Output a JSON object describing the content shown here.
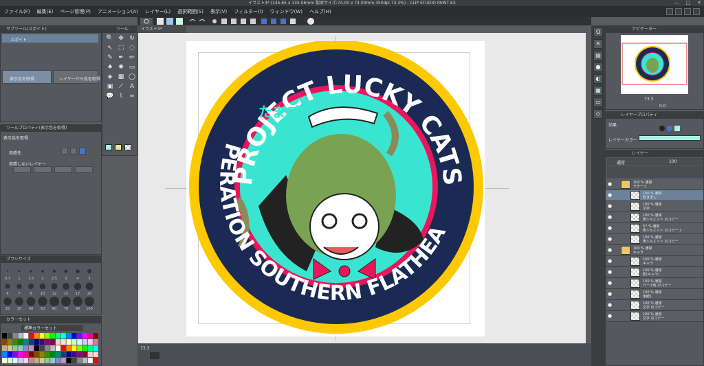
{
  "titlebar": {
    "title": "イラスト3* (145.65 x 135.06mm 製本サイズ:74.00 x 74.00mm 350dpi 73.3%) - CLIP STUDIO PAINT EX",
    "min": "—",
    "max": "□",
    "close": "✕"
  },
  "menu": [
    "ファイル(F)",
    "編集(E)",
    "ページ管理(P)",
    "アニメーション(A)",
    "レイヤー(L)",
    "選択範囲(S)",
    "表示(V)",
    "フィルター(I)",
    "ウィンドウ(W)",
    "ヘルプ(H)"
  ],
  "doc_tab": "イラスト3*",
  "panels": {
    "subtool_header": "サブツール(スポイト)",
    "subtool_active": "スポイト",
    "subtool_items": [
      "表示色を取得",
      "レイヤーから色を取得"
    ],
    "toolprop_header": "ツールプロパティ(表示色を取得)",
    "toolprop_title": "表示色を取得",
    "reference": "参照先",
    "exclude": "参照しないレイヤー",
    "tool_header": "ツール",
    "brushsize_header": "ブラシサイズ",
    "brush_sizes": [
      "0.7",
      "1",
      "1.5",
      "2",
      "2.5",
      "3",
      "4",
      "5",
      "6",
      "7",
      "8",
      "10",
      "12",
      "15",
      "17",
      "20",
      "25",
      "30",
      "40",
      "50",
      "60",
      "70",
      "80",
      "100"
    ],
    "colorset_header": "カラーセット",
    "colorset_name": "標準カラーセット",
    "navigator_header": "ナビゲーター",
    "navigator_zoom": "73.3",
    "navigator_angle": "0.0",
    "layerprop_header": "レイヤープロパティ",
    "effect": "効果",
    "layer_color": "レイヤーカラー",
    "layer_header": "レイヤー",
    "blend_mode": "通常",
    "opacity": "100"
  },
  "layers": [
    {
      "label": "100 % 通常",
      "name": "モチーフ",
      "folder": true
    },
    {
      "label": "100 % 通常",
      "name": "吹き出し",
      "selected": true
    },
    {
      "label": "100 % 通常",
      "name": "文字"
    },
    {
      "label": "100 % 通常",
      "name": "魚シルエット のコピー"
    },
    {
      "label": "57 % 通常",
      "name": "魚シルエット のコピー 2"
    },
    {
      "label": "100 % 通常",
      "name": "魚シルエット のコピー"
    },
    {
      "label": "100 % 通常",
      "name": "キャラ",
      "folder": true
    },
    {
      "label": "100 % 通常",
      "name": "キャラ"
    },
    {
      "label": "100 % 通常",
      "name": "影(キャラ)"
    },
    {
      "label": "100 % 通常",
      "name": "ベース色 のコピー"
    },
    {
      "label": "100 % 通常",
      "name": "用紙1"
    },
    {
      "label": "100 % 通常",
      "name": "文字 のコピー"
    },
    {
      "label": "100 % 通常",
      "name": "文字 のコピー"
    }
  ],
  "artwork": {
    "top_text": "PROJECT LUCKY CATS",
    "bottom_text": "OPERATION SOUTHERN FLATHEAD",
    "small_text": "たまご",
    "ring_outer": "#fdc901",
    "ring_mid": "#1b2a55",
    "ring_inner": "#e8175d",
    "bg": "#39e5d0",
    "hair": "#7aa253"
  },
  "status": {
    "zoom": "73.3"
  }
}
